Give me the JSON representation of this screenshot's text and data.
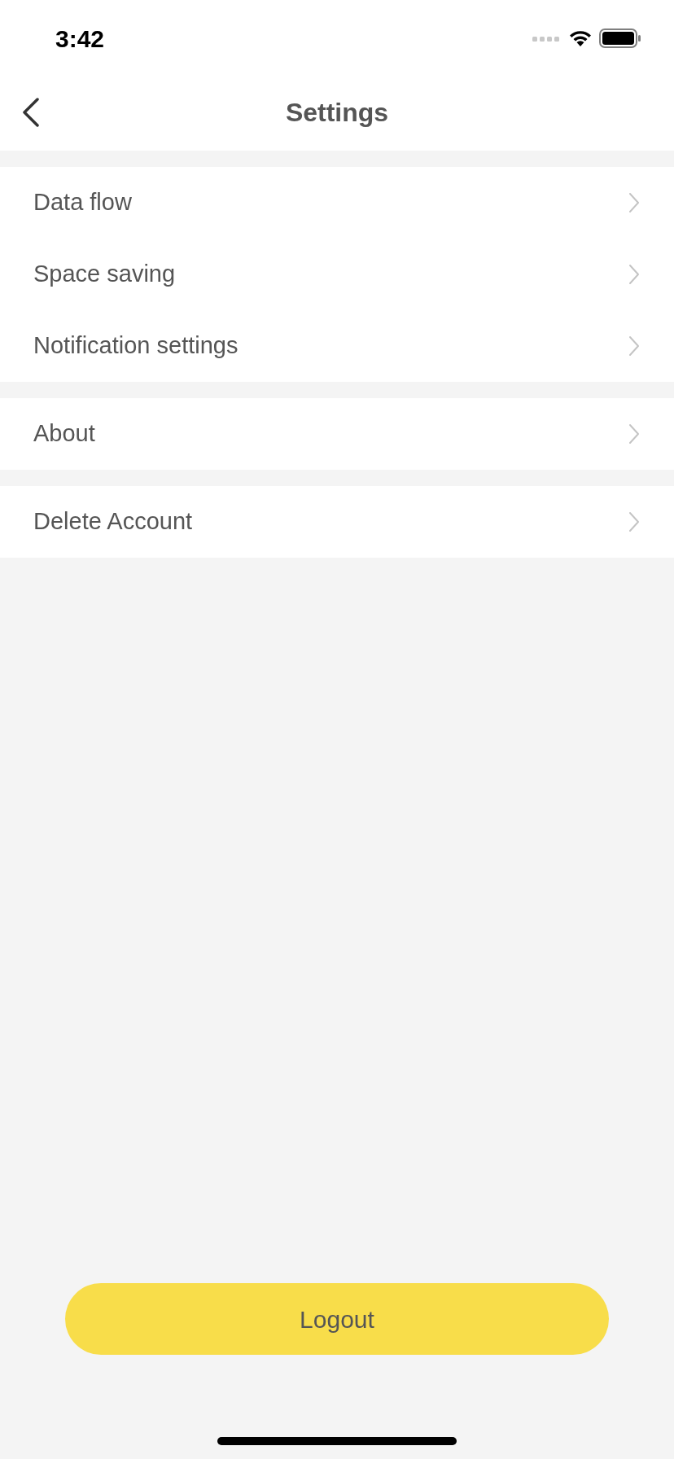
{
  "status_bar": {
    "time": "3:42"
  },
  "nav": {
    "title": "Settings"
  },
  "groups": [
    {
      "items": [
        {
          "label": "Data flow"
        },
        {
          "label": "Space saving"
        },
        {
          "label": "Notification settings"
        }
      ]
    },
    {
      "items": [
        {
          "label": "About"
        }
      ]
    },
    {
      "items": [
        {
          "label": "Delete Account"
        }
      ]
    }
  ],
  "logout_button": {
    "label": "Logout"
  }
}
